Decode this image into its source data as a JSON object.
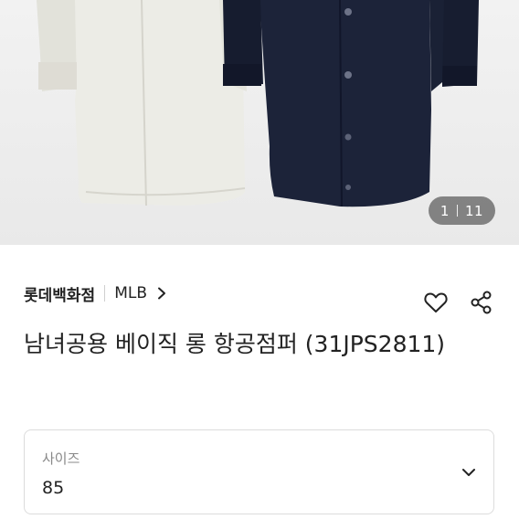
{
  "gallery": {
    "current": "1",
    "total": "11"
  },
  "product": {
    "store": "롯데백화점",
    "brand": "MLB",
    "title": "남녀공용 베이직 롱 항공점퍼 (31JPS2811)"
  },
  "option": {
    "label": "사이즈",
    "value": "85"
  },
  "icons": {
    "wishlist": "heart-outline-icon",
    "share": "share-icon",
    "brand_link": "chevron-right-icon",
    "dropdown": "chevron-down-icon"
  },
  "colors": {
    "coat_white": "#e8e8e0",
    "coat_navy": "#1b2238",
    "background": "#eeeeee"
  }
}
